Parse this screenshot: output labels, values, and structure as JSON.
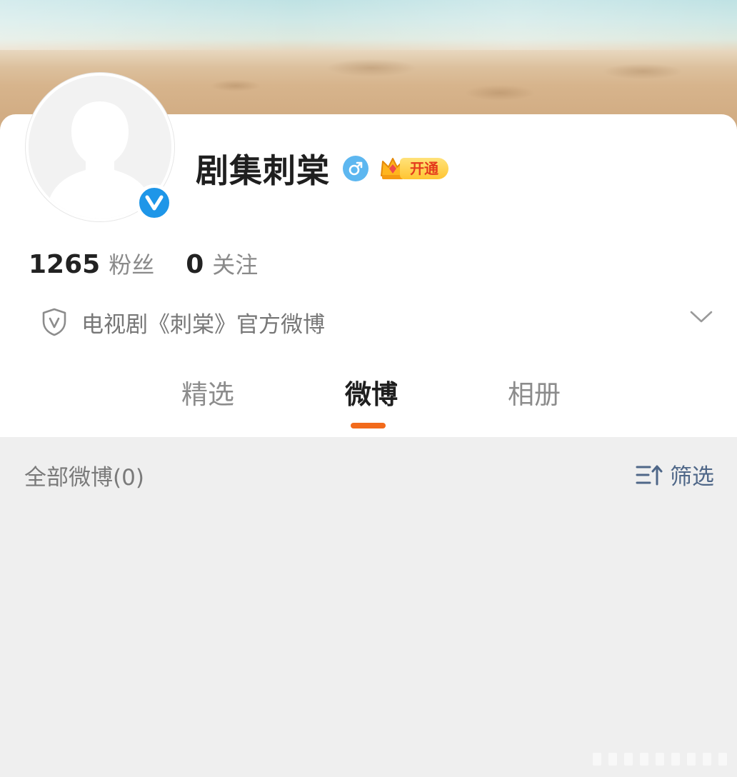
{
  "profile": {
    "name": "剧集刺棠",
    "gender_icon": "male-icon",
    "vip_label": "开通",
    "description": "电视剧《刺棠》官方微博"
  },
  "stats": {
    "followers_count": "1265",
    "followers_label": "粉丝",
    "following_count": "0",
    "following_label": "关注"
  },
  "tabs": [
    {
      "label": "精选",
      "active": false
    },
    {
      "label": "微博",
      "active": true
    },
    {
      "label": "相册",
      "active": false
    }
  ],
  "feed": {
    "title": "全部微博(0)",
    "filter_label": "筛选"
  },
  "colors": {
    "accent": "#f26a1b",
    "verified": "#1e96e8",
    "gender": "#5db7f0",
    "link": "#4f6788"
  }
}
